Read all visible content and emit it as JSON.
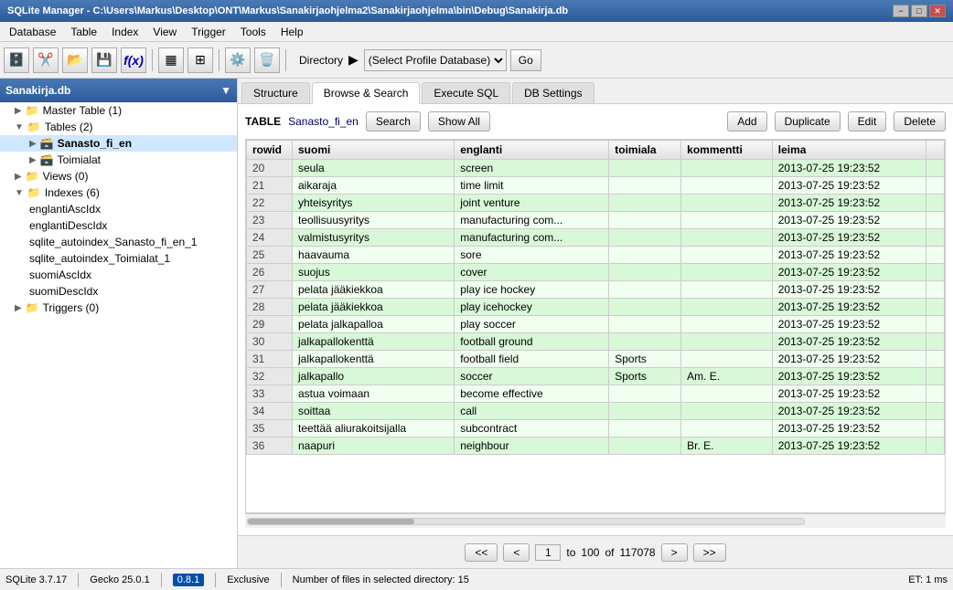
{
  "titlebar": {
    "title": "SQLite Manager - C:\\Users\\Markus\\Desktop\\ONT\\Markus\\Sanakirjaohjelma2\\Sanakirjaohjelma\\bin\\Debug\\Sanakirja.db",
    "min_label": "−",
    "max_label": "□",
    "close_label": "✕"
  },
  "menubar": {
    "items": [
      "Database",
      "Table",
      "Index",
      "View",
      "Trigger",
      "Tools",
      "Help"
    ]
  },
  "toolbar": {
    "directory_label": "Directory",
    "profile_placeholder": "(Select Profile Database)",
    "go_label": "Go"
  },
  "leftpanel": {
    "db_label": "Sanakirja.db",
    "tree": [
      {
        "label": "Master Table (1)",
        "indent": 1,
        "icon": "▶",
        "type": "folder"
      },
      {
        "label": "Tables (2)",
        "indent": 1,
        "icon": "▼",
        "type": "folder"
      },
      {
        "label": "Sanasto_fi_en",
        "indent": 2,
        "icon": "▶",
        "type": "table",
        "selected": true
      },
      {
        "label": "Toimialat",
        "indent": 2,
        "icon": "▶",
        "type": "table"
      },
      {
        "label": "Views (0)",
        "indent": 1,
        "icon": "▶",
        "type": "folder"
      },
      {
        "label": "Indexes (6)",
        "indent": 1,
        "icon": "▼",
        "type": "folder"
      },
      {
        "label": "englantiAscIdx",
        "indent": 2,
        "type": "index"
      },
      {
        "label": "englantiDescIdx",
        "indent": 2,
        "type": "index"
      },
      {
        "label": "sqlite_autoindex_Sanasto_fi_en_1",
        "indent": 2,
        "type": "index"
      },
      {
        "label": "sqlite_autoindex_Toimialat_1",
        "indent": 2,
        "type": "index"
      },
      {
        "label": "suomiAscIdx",
        "indent": 2,
        "type": "index"
      },
      {
        "label": "suomiDescIdx",
        "indent": 2,
        "type": "index"
      },
      {
        "label": "Triggers (0)",
        "indent": 1,
        "icon": "▶",
        "type": "folder"
      }
    ]
  },
  "tabs": [
    "Structure",
    "Browse & Search",
    "Execute SQL",
    "DB Settings"
  ],
  "active_tab": "Browse & Search",
  "content": {
    "table_label": "TABLE",
    "table_name": "Sanasto_fi_en",
    "search_btn": "Search",
    "show_all_btn": "Show All",
    "add_btn": "Add",
    "duplicate_btn": "Duplicate",
    "edit_btn": "Edit",
    "delete_btn": "Delete",
    "columns": [
      "rowid",
      "suomi",
      "englanti",
      "toimiala",
      "kommentti",
      "leima"
    ],
    "rows": [
      {
        "rowid": "20",
        "suomi": "seula",
        "englanti": "screen",
        "toimiala": "",
        "kommentti": "",
        "leima": "2013-07-25 19:23:52"
      },
      {
        "rowid": "21",
        "suomi": "aikaraja",
        "englanti": "time limit",
        "toimiala": "",
        "kommentti": "",
        "leima": "2013-07-25 19:23:52"
      },
      {
        "rowid": "22",
        "suomi": "yhteisyritys",
        "englanti": "joint venture",
        "toimiala": "",
        "kommentti": "",
        "leima": "2013-07-25 19:23:52"
      },
      {
        "rowid": "23",
        "suomi": "teollisuusyritys",
        "englanti": "manufacturing com...",
        "toimiala": "",
        "kommentti": "",
        "leima": "2013-07-25 19:23:52"
      },
      {
        "rowid": "24",
        "suomi": "valmistusyritys",
        "englanti": "manufacturing com...",
        "toimiala": "",
        "kommentti": "",
        "leima": "2013-07-25 19:23:52"
      },
      {
        "rowid": "25",
        "suomi": "haavauma",
        "englanti": "sore",
        "toimiala": "",
        "kommentti": "",
        "leima": "2013-07-25 19:23:52"
      },
      {
        "rowid": "26",
        "suomi": "suojus",
        "englanti": "cover",
        "toimiala": "",
        "kommentti": "",
        "leima": "2013-07-25 19:23:52"
      },
      {
        "rowid": "27",
        "suomi": "pelata jääkiekkoa",
        "englanti": "play ice hockey",
        "toimiala": "",
        "kommentti": "",
        "leima": "2013-07-25 19:23:52"
      },
      {
        "rowid": "28",
        "suomi": "pelata jääkiekkoa",
        "englanti": "play icehockey",
        "toimiala": "",
        "kommentti": "",
        "leima": "2013-07-25 19:23:52"
      },
      {
        "rowid": "29",
        "suomi": "pelata jalkapalloa",
        "englanti": "play soccer",
        "toimiala": "",
        "kommentti": "",
        "leima": "2013-07-25 19:23:52"
      },
      {
        "rowid": "30",
        "suomi": "jalkapallokenttä",
        "englanti": "football ground",
        "toimiala": "",
        "kommentti": "",
        "leima": "2013-07-25 19:23:52"
      },
      {
        "rowid": "31",
        "suomi": "jalkapallokenttä",
        "englanti": "football field",
        "toimiala": "Sports",
        "kommentti": "",
        "leima": "2013-07-25 19:23:52"
      },
      {
        "rowid": "32",
        "suomi": "jalkapallo",
        "englanti": "soccer",
        "toimiala": "Sports",
        "kommentti": "Am. E.",
        "leima": "2013-07-25 19:23:52"
      },
      {
        "rowid": "33",
        "suomi": "astua voimaan",
        "englanti": "become effective",
        "toimiala": "",
        "kommentti": "",
        "leima": "2013-07-25 19:23:52"
      },
      {
        "rowid": "34",
        "suomi": "soittaa",
        "englanti": "call",
        "toimiala": "",
        "kommentti": "",
        "leima": "2013-07-25 19:23:52"
      },
      {
        "rowid": "35",
        "suomi": "teettää aliurakoitsijalla",
        "englanti": "subcontract",
        "toimiala": "",
        "kommentti": "",
        "leima": "2013-07-25 19:23:52"
      },
      {
        "rowid": "36",
        "suomi": "naapuri",
        "englanti": "neighbour",
        "toimiala": "",
        "kommentti": "Br. E.",
        "leima": "2013-07-25 19:23:52"
      }
    ]
  },
  "pagination": {
    "first_label": "<<",
    "prev_label": "<",
    "next_label": ">",
    "last_label": ">>",
    "current_page": "1",
    "page_to": "to",
    "page_size": "100",
    "page_of": "of",
    "total_records": "117078"
  },
  "statusbar": {
    "sqlite_version": "SQLite 3.7.17",
    "gecko_version": "Gecko 25.0.1",
    "plugin_version": "0.8.1",
    "mode": "Exclusive",
    "file_info": "Number of files in selected directory: 15",
    "et": "ET: 1 ms"
  }
}
